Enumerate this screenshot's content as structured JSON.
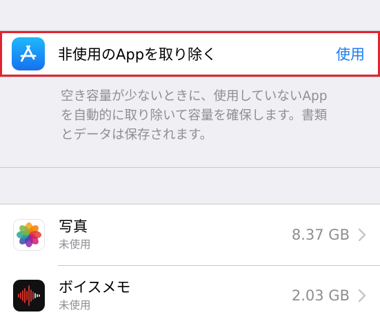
{
  "offload": {
    "label": "非使用のAppを取り除く",
    "action": "使用",
    "icon": "app-store-icon",
    "highlight_color": "#e0242f",
    "action_color": "#1a7cf5"
  },
  "description": {
    "line1": "空き容量が少ないときに、使用していないApp",
    "line2": "を自動的に取り除いて容量を確保します。書類",
    "line3": "とデータは保存されます。"
  },
  "apps": [
    {
      "name": "写真",
      "status": "未使用",
      "size": "8.37 GB",
      "icon": "photos-icon"
    },
    {
      "name": "ボイスメモ",
      "status": "未使用",
      "size": "2.03 GB",
      "icon": "voice-memos-icon"
    }
  ]
}
